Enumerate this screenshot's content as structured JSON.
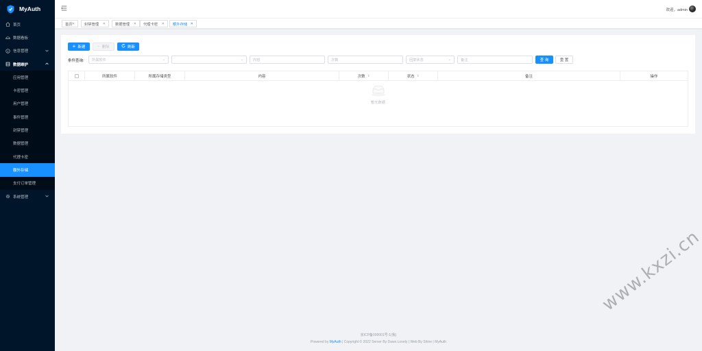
{
  "app": {
    "name": "MyAuth"
  },
  "sidebar": {
    "items": [
      {
        "label": "首页",
        "icon": "home-icon"
      },
      {
        "label": "数据看板",
        "icon": "dashboard-icon"
      },
      {
        "label": "信息管理",
        "icon": "info-icon"
      },
      {
        "label": "数据维护",
        "icon": "database-icon"
      },
      {
        "label": "系统管理",
        "icon": "gear-icon"
      }
    ],
    "submenu": [
      "应用管理",
      "卡密管理",
      "用户管理",
      "事件管理",
      "封禁管理",
      "数据管理",
      "代理卡密",
      "额外存储",
      "支付订单管理"
    ]
  },
  "header": {
    "welcome": "欢迎，admin"
  },
  "tags": [
    "首页",
    "封禁管理",
    "数据管理",
    "代理卡密",
    "额外存储"
  ],
  "toolbar": {
    "new_label": "新建",
    "delete_label": "删除",
    "refresh_label": "刷新"
  },
  "filters": {
    "label": "条件查询:",
    "software_placeholder": "所属软件",
    "content_placeholder": "内容",
    "count_placeholder": "次数",
    "status_placeholder": "回复状态",
    "remark_placeholder": "备注",
    "query_label": "查 询",
    "reset_label": "重 置"
  },
  "table": {
    "columns": [
      "所属软件",
      "所属存储类型",
      "内容",
      "次数",
      "状态",
      "备注",
      "操作"
    ],
    "empty_text": "暂无数据"
  },
  "footer": {
    "icp": "京ICP备000001号-1(我)",
    "powered_prefix": "Powered by ",
    "powered_brand": "MyAuth",
    "powered_suffix": " | Copyright © 2022 Server By Dawn.Lonely | Web By Shine | MyAuth"
  },
  "watermark": "www.kxzi.cn",
  "colors": {
    "sidebar": "#001529",
    "accent": "#1890ff",
    "background": "#f0f2f5"
  }
}
